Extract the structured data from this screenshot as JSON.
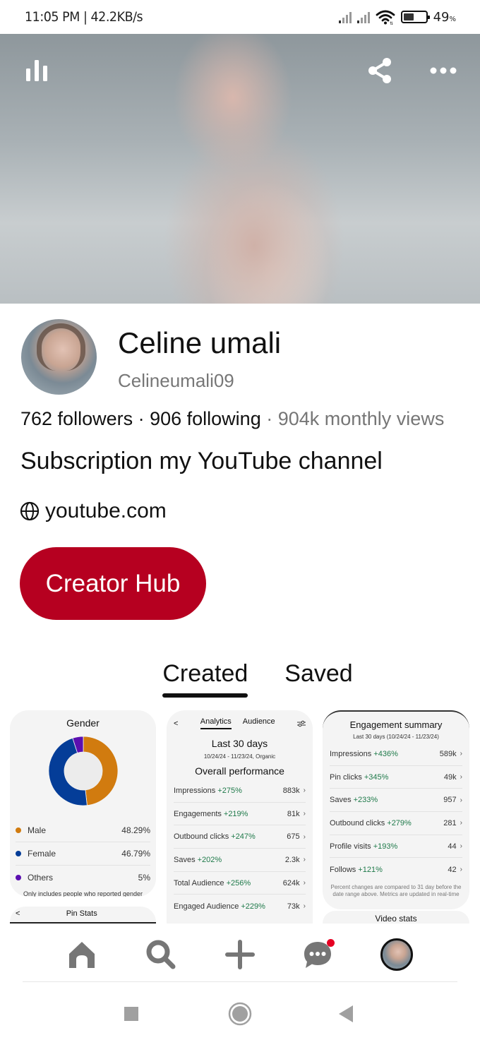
{
  "status_bar": {
    "time_speed": "11:05 PM | 42.2KB/s",
    "battery_percent": 49,
    "battery_label": "49",
    "battery_unit": "%",
    "icons": [
      "signal-icon",
      "signal-icon",
      "wifi-icon",
      "battery-icon"
    ]
  },
  "cover": {
    "actions": {
      "stats": "stats-icon",
      "share": "share-icon",
      "more": "more-icon"
    }
  },
  "profile": {
    "name": "Celine umali",
    "username": "Celineumali09",
    "followers": "762 followers",
    "separator": " · ",
    "following": "906 following",
    "monthly_views": " · 904k monthly views",
    "bio": "Subscription my YouTube channel",
    "website": "youtube.com",
    "creator_hub_label": "Creator Hub",
    "accent_color": "#b60020"
  },
  "tabs": [
    {
      "label": "Created",
      "active": true
    },
    {
      "label": "Saved",
      "active": false
    }
  ],
  "gender_card": {
    "title": "Gender",
    "legend": [
      {
        "label": "Male",
        "value": "48.29%",
        "color": "#d17b0f"
      },
      {
        "label": "Female",
        "value": "46.79%",
        "color": "#043d98"
      },
      {
        "label": "Others",
        "value": "5%",
        "color": "#5b0fb0"
      }
    ],
    "footnote": "Only includes people who reported gender"
  },
  "pin_stats_card": {
    "back": "<",
    "title": "Pin Stats"
  },
  "analytics_card": {
    "back": "<",
    "tabs": [
      {
        "label": "Analytics",
        "active": true
      },
      {
        "label": "Audience",
        "active": false
      }
    ],
    "heading": "Last 30 days",
    "subheading": "10/24/24 - 11/23/24, Organic",
    "section_title": "Overall performance",
    "metrics": [
      {
        "label": "Impressions",
        "change": "+275%",
        "value": "883k"
      },
      {
        "label": "Engagements",
        "change": "+219%",
        "value": "81k"
      },
      {
        "label": "Outbound clicks",
        "change": "+247%",
        "value": "675"
      },
      {
        "label": "Saves",
        "change": "+202%",
        "value": "2.3k"
      },
      {
        "label": "Total Audience",
        "change": "+256%",
        "value": "624k"
      },
      {
        "label": "Engaged Audience",
        "change": "+229%",
        "value": "73k"
      }
    ]
  },
  "engagement_card": {
    "title": "Engagement summary",
    "subtitle": "Last 30 days (10/24/24 - 11/23/24)",
    "metrics": [
      {
        "label": "Impressions",
        "change": "+436%",
        "value": "589k"
      },
      {
        "label": "Pin clicks",
        "change": "+345%",
        "value": "49k"
      },
      {
        "label": "Saves",
        "change": "+233%",
        "value": "957"
      },
      {
        "label": "Outbound clicks",
        "change": "+279%",
        "value": "281"
      },
      {
        "label": "Profile visits",
        "change": "+193%",
        "value": "44"
      },
      {
        "label": "Follows",
        "change": "+121%",
        "value": "42"
      }
    ],
    "footnote": "Percent changes are compared to 31 day before the date range above. Metrics are updated in real-time"
  },
  "video_card": {
    "title": "Video stats"
  },
  "bottom_nav": {
    "items": [
      "home-icon",
      "search-icon",
      "create-icon",
      "messages-icon",
      "profile-avatar"
    ],
    "messages_has_notification": true,
    "notification_color": "#e60023"
  },
  "system_nav": {
    "items": [
      "recent-apps-icon",
      "home-circle-icon",
      "back-triangle-icon"
    ]
  },
  "chart_data": {
    "type": "pie",
    "title": "Gender",
    "categories": [
      "Male",
      "Female",
      "Others"
    ],
    "values": [
      48.29,
      46.79,
      5
    ],
    "colors": [
      "#d17b0f",
      "#043d98",
      "#5b0fb0"
    ],
    "donut": true,
    "legend": "bottom"
  }
}
